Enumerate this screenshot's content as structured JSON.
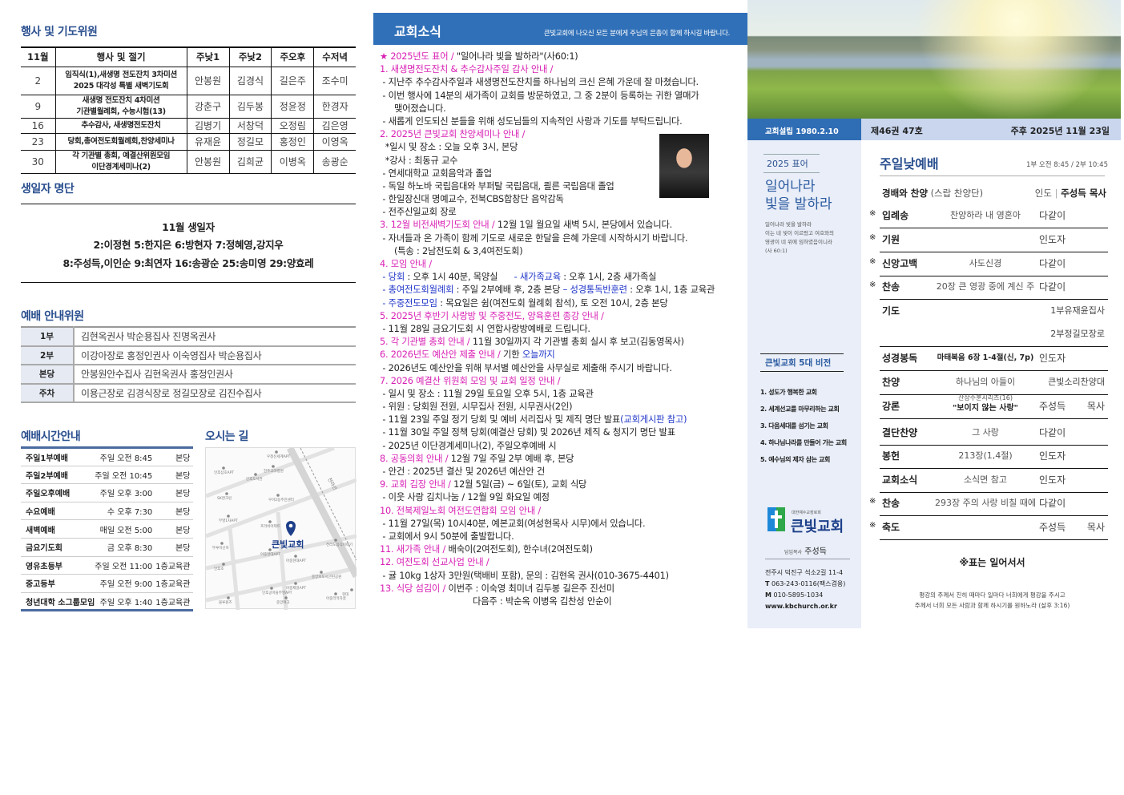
{
  "colors": {
    "magenta": "#d81fb4",
    "blue": "#1f35c8",
    "text": "#222",
    "title": "#2a4f8f",
    "bar": "#2f6db5"
  },
  "events": {
    "title": "행사 및 기도위원",
    "headers": [
      "11월",
      "행사 및 절기",
      "주낮1",
      "주낮2",
      "주오후",
      "수저녁"
    ],
    "rows": [
      {
        "day": "2",
        "event": [
          "임직식(1),새생명 전도잔치 3차미션",
          "2025 대각성 특별 새벽기도회"
        ],
        "names": [
          "안봉원",
          "김경식",
          "길은주",
          "조수미"
        ]
      },
      {
        "day": "9",
        "event": [
          "새생명 전도잔치 4차미션",
          "기관별월례회, 수능시험(13)"
        ],
        "names": [
          "강춘구",
          "김두봉",
          "정윤정",
          "한경자"
        ]
      },
      {
        "day": "16",
        "event": [
          "추수감사, 새생명전도잔치"
        ],
        "names": [
          "김병기",
          "서창덕",
          "오정림",
          "김은영"
        ]
      },
      {
        "day": "23",
        "event": [
          "당회,총여전도회월례회,찬양세미나"
        ],
        "names": [
          "유재윤",
          "정길모",
          "홍정인",
          "이영옥"
        ]
      },
      {
        "day": "30",
        "event": [
          "각 기관별 총회, 예결산위원모임",
          "이단경계세미나(2)"
        ],
        "names": [
          "안봉원",
          "김희균",
          "이병옥",
          "송광순"
        ]
      }
    ]
  },
  "birthdays": {
    "title": "생일자 명단",
    "lines": [
      "11월  생일자",
      "2:이정현  5:한지은  6:방현자  7:정혜영,강지우",
      "8:주성득,이인순  9:최연자  16:송광순  25:송미영  29:양효레"
    ]
  },
  "ushers": {
    "title": "예배 안내위원",
    "rows": [
      {
        "label": "1부",
        "names": "김현옥권사  박순용집사  진명옥권사"
      },
      {
        "label": "2부",
        "names": "이강아장로  홍정인권사  이숙영집사  박순용집사"
      },
      {
        "label": "본당",
        "names": "안봉원안수집사  김현옥권사  홍정인권사"
      },
      {
        "label": "주차",
        "names": "이용근장로  김경식장로  정길모장로  김진수집사"
      }
    ]
  },
  "times": {
    "title": "예배시간안내",
    "rows": [
      [
        "주일1부예배",
        "주일 오전  8:45",
        "본당"
      ],
      [
        "주일2부예배",
        "주일 오전 10:45",
        "본당"
      ],
      [
        "주일오후예배",
        "주일 오후  3:00",
        "본당"
      ],
      [
        "수요예배",
        "수 오후  7:30",
        "본당"
      ],
      [
        "새벽예배",
        "매일 오전  5:00",
        "본당"
      ],
      [
        "금요기도회",
        "금 오후  8:30",
        "본당"
      ],
      [
        "영유초등부",
        "주일 오전 11:00",
        "1층교육관"
      ],
      [
        "중고등부",
        "주일 오전  9:00",
        "1층교육관"
      ],
      [
        "청년대학 소그룹모임",
        "주일 오후  1:40",
        "1층교육관"
      ]
    ]
  },
  "map": {
    "title": "오시는 길",
    "church": "큰빛교회",
    "rail": "전라선",
    "places": [
      "우정신세계APT",
      "인후삼호APT",
      "인후도서관",
      "전주고려병원",
      "SK엔크린",
      "우아2동주민센터",
      "부영1차APT",
      "프라비아제트",
      "뚜루이신하",
      "아중현대APT",
      "인후초",
      "아중현대APT",
      "전라도음식이야기",
      "인후공마을부영APT",
      "아중제일APT",
      "중앙보도시근린공원",
      "블루원즈",
      "중앙여고",
      "아중리먹자골",
      "현대"
    ]
  },
  "news": {
    "title": "교회소식",
    "subtitle": "큰빛교회에 나오신 모든 분에게 주님의 은총이 함께 하시길 바랍니다.",
    "lines": [
      {
        "s": [
          [
            "★ 2025년도 표어 / ",
            "magenta"
          ],
          [
            "\"일어나라 빛을 발하라\"(사60:1)",
            "text"
          ]
        ]
      },
      {
        "s": [
          [
            "1. 새생명전도잔치 & 추수감사주일 감사 안내 /",
            "magenta"
          ]
        ]
      },
      {
        "s": [
          [
            " - 지난주 추수감사주일과 새생명전도잔치를 하나님의 크신 은혜 가운데 잘 마쳤습니다.",
            "text"
          ]
        ]
      },
      {
        "s": [
          [
            " - 이번 행사에 14분의 새가족이 교회를 방문하였고, 그 중 2분이 등록하는 귀한 열매가",
            "text"
          ]
        ]
      },
      {
        "i": 1,
        "s": [
          [
            "맺어졌습니다.",
            "text"
          ]
        ]
      },
      {
        "s": [
          [
            " - 새롭게 인도되신 분들을 위해 성도님들의 지속적인 사랑과 기도를 부탁드립니다.",
            "text"
          ]
        ]
      },
      {
        "s": [
          [
            "2. 2025년 큰빛교회 찬양세미나 안내 /",
            "magenta"
          ]
        ]
      },
      {
        "s": [
          [
            "  *일시 및 장소 : 오늘 오후 3시, 본당",
            "text"
          ]
        ]
      },
      {
        "s": [
          [
            "  *강사 : 최동규 교수",
            "text"
          ]
        ]
      },
      {
        "s": [
          [
            " - 연세대학교 교회음악과 졸업",
            "text"
          ]
        ]
      },
      {
        "s": [
          [
            " - 독일 하노바 국립음대와 부퍼탈 국립음대, 쾰른 국립음대 졸업",
            "text"
          ]
        ]
      },
      {
        "s": [
          [
            " - 한일장신대 명예교수, 전북CBS합창단 음악감독",
            "text"
          ]
        ]
      },
      {
        "s": [
          [
            " - 전주신일교회 장로",
            "text"
          ]
        ]
      },
      {
        "s": [
          [
            "3. 12월 비전새벽기도회 안내 / ",
            "magenta"
          ],
          [
            "12월 1일 월요일 새벽 5시, 본당에서 있습니다.",
            "text"
          ]
        ]
      },
      {
        "s": [
          [
            " - 자녀들과 온 가족이 함께 기도로 새로운 한달을 은혜 가운데 시작하시기 바랍니다.",
            "text"
          ]
        ]
      },
      {
        "i": 1,
        "s": [
          [
            "(특송 : 2남전도회 & 3,4여전도회)",
            "text"
          ]
        ]
      },
      {
        "s": [
          [
            "4. 모임 안내 /",
            "magenta"
          ]
        ]
      },
      {
        "s": [
          [
            " - 당회",
            "blue"
          ],
          [
            " : 오후 1시 40분, 목양실      ",
            "text"
          ],
          [
            "- 새가족교육",
            "blue"
          ],
          [
            " : 오후 1시, 2층 새가족실",
            "text"
          ]
        ]
      },
      {
        "s": [
          [
            " - 총여전도회월례회",
            "blue"
          ],
          [
            " : 주일 2부예배 후, 2층 본당 ",
            "text"
          ],
          [
            "– 성경통독반훈련",
            "blue"
          ],
          [
            " : 오후 1시, 1층 교육관",
            "text"
          ]
        ]
      },
      {
        "s": [
          [
            " - 주중전도모임",
            "blue"
          ],
          [
            " : 목요일은 쉼(여전도회 월례회 참석), 토 오전 10시, 2층 본당",
            "text"
          ]
        ]
      },
      {
        "s": [
          [
            "5. 2025년 후반기 사랑방 및 주중전도, 양육훈련 종강 안내 /",
            "magenta"
          ]
        ]
      },
      {
        "s": [
          [
            " - 11월 28일 금요기도회 시 연합사랑방예배로 드립니다.",
            "text"
          ]
        ]
      },
      {
        "s": [
          [
            "5. 각 기관별 총회 안내 / ",
            "magenta"
          ],
          [
            "11월 30일까지 각 기관별 총회 실시 후 보고(김동영목사)",
            "text"
          ]
        ]
      },
      {
        "s": [
          [
            "6. 2026년도 예산안 제출 안내 / ",
            "magenta"
          ],
          [
            "기한 ",
            "text"
          ],
          [
            "오늘까지",
            "blue"
          ]
        ]
      },
      {
        "s": [
          [
            " - 2026년도 예산안을 위해 부서별 예산안을 사무실로 제출해 주시기 바랍니다.",
            "text"
          ]
        ]
      },
      {
        "s": [
          [
            "7. 2026 예결산 위원회 모임 및 교회 일정 안내 /",
            "magenta"
          ]
        ]
      },
      {
        "s": [
          [
            " - 일시 및 장소 : 11월 29일 토요일 오후 5시, 1층 교육관",
            "text"
          ]
        ]
      },
      {
        "s": [
          [
            " - 위원 : 당회원 전원, 시무집사 전원, 시무권사(2인)",
            "text"
          ]
        ]
      },
      {
        "s": [
          [
            " - 11월 23일 주일 정기 당회 및 예비 서리집사 및 제직 명단 발표",
            "text"
          ],
          [
            "(교회게시판 참고)",
            "blue"
          ]
        ]
      },
      {
        "s": [
          [
            " - 11월 30일 주일 정책 당회(예결산 당회) 및 2026년 제직 & 청지기 명단 발표",
            "text"
          ]
        ]
      },
      {
        "s": [
          [
            " - 2025년 이단경계세미나(2), 주일오후예배 시",
            "text"
          ]
        ]
      },
      {
        "s": [
          [
            "8. 공동의회 안내 / ",
            "magenta"
          ],
          [
            "12월 7일 주일 2부 예배 후, 본당",
            "text"
          ]
        ]
      },
      {
        "s": [
          [
            " - 안건 : 2025년 결산 및 2026년 예산안 건",
            "text"
          ]
        ]
      },
      {
        "s": [
          [
            "9. 교회 김장 안내 / ",
            "magenta"
          ],
          [
            "12월 5일(금) ~ 6일(토), 교회 식당",
            "text"
          ]
        ]
      },
      {
        "s": [
          [
            " - 이웃 사랑 김치나눔 / 12월 9일 화요일 예정",
            "text"
          ]
        ]
      },
      {
        "s": [
          [
            "10. 전북제일노회 여전도연합회 모임 안내 /",
            "magenta"
          ]
        ]
      },
      {
        "s": [
          [
            " - 11월 27일(목) 10시40분, 예본교회(여성현목사 시무)에서 있습니다.",
            "text"
          ]
        ]
      },
      {
        "s": [
          [
            " - 교회에서 9시 50분에 출발합니다.",
            "text"
          ]
        ]
      },
      {
        "s": [
          [
            "11. 새가족 안내 / ",
            "magenta"
          ],
          [
            "배숙이(2여전도회), 한수녀(2여전도회)",
            "text"
          ]
        ]
      },
      {
        "s": [
          [
            "12. 여전도회 선교사업 안내 /",
            "magenta"
          ]
        ]
      },
      {
        "s": [
          [
            " - 귤 10kg 1상자 3만원(택배비 포함), 문의 : 김현옥 권사(010-3675-4401)",
            "text"
          ]
        ]
      },
      {
        "s": [
          [
            "13. 식당 섬김이 / ",
            "magenta"
          ],
          [
            "이번주 : 이숙영 최미녀 김두봉 길은주 진선미",
            "text"
          ]
        ]
      },
      {
        "i": 2,
        "s": [
          [
            "다음주 : 박순옥 이병옥 김찬성 안순이",
            "text"
          ]
        ]
      }
    ]
  },
  "cover": {
    "founded": "교회설립 1980.2.10",
    "volume": "제46권 47호",
    "date": "주후 2025년 11월 23일",
    "motto_label": "2025 표어",
    "motto": [
      "일어나라",
      "빛을 발하라"
    ],
    "verse": [
      "일어나라 빛을 발하라",
      "이는 네 빛이 이르렀고 여호와의",
      "영광이 네 위에 임하였음이니라",
      "(사 60:1)"
    ],
    "vision_title": "큰빛교회 5대 비전",
    "visions": [
      "1.  성도가 행복한 교회",
      "2.  세계선교를 마무리하는 교회",
      "3.  다음세대를 섬기는 교회",
      "4.  하나님나라를 만들어 가는 교회",
      "5.  예수님의 제자 삼는 교회"
    ],
    "logo_sub": "대한예수교장로회",
    "logo_name": "큰빛교회",
    "pastor_label": "담임목사",
    "pastor": "주성득",
    "address": "전주시 덕진구 석소2길 11-4",
    "tel_label": "T",
    "tel": "063-243-0116(팩스겸용)",
    "mobile_label": "M",
    "mobile": "010-5895-1034",
    "web": "www.kbchurch.or.kr"
  },
  "worship": {
    "title": "주일낮예배",
    "time": "1부 오전 8:45 / 2부 10:45",
    "intro": {
      "name": "경배와 찬양",
      "paren": "(스랍 찬양단)",
      "lead": "인도",
      "sep": "|",
      "leader": "주성득 목사"
    },
    "rows": [
      {
        "mark": "※",
        "name": "입례송",
        "mid": "찬양하라 내 영혼아",
        "right": "다같이"
      },
      {
        "mark": "※",
        "name": "기원",
        "mid": "",
        "right": "인도자"
      },
      {
        "mark": "※",
        "name": "신앙고백",
        "mid": "사도신경",
        "right": "다같이"
      },
      {
        "mark": "※",
        "name": "찬송",
        "mid": "20장 큰 영광 중에 계신 주",
        "right": "다같이"
      },
      {
        "mark": "",
        "name": "기도",
        "mid": "",
        "right": "1부유재윤집사"
      },
      {
        "mark": "",
        "name": "",
        "mid": "",
        "right": "2부정길모장로"
      },
      {
        "mark": "",
        "name": "성경봉독",
        "mid": "마태복음 6장 1-4절(신, 7p)",
        "right": "인도자"
      },
      {
        "mark": "",
        "name": "찬양",
        "mid": "하나님의 아들이",
        "right": "큰빛소리찬양대"
      },
      {
        "mark": "",
        "name": "강론",
        "mid": "산상수훈시리즈(16)",
        "mid2": "\"보이지 않는 사랑\"",
        "right": "주성득 목사"
      },
      {
        "mark": "",
        "name": "결단찬양",
        "mid": "그 사랑",
        "right": "다같이"
      },
      {
        "mark": "",
        "name": "봉헌",
        "mid": "213장(1,4절)",
        "right": "인도자"
      },
      {
        "mark": "",
        "name": "교회소식",
        "mid": "소식면 참고",
        "right": "인도자"
      },
      {
        "mark": "※",
        "name": "찬송",
        "mid": "293장 주의 사랑 비칠 때에",
        "right": "다같이"
      },
      {
        "mark": "※",
        "name": "축도",
        "mid": "",
        "right": "주성득 목사"
      }
    ],
    "note": "※표는 일어서서",
    "blessing": [
      "평강의 주께서 친히 때마다 일마다 너희에게 평강을 주시고",
      "주께서 너희 모든 사람과 함께 하시기를 원하노라 (살후 3:16)"
    ]
  }
}
